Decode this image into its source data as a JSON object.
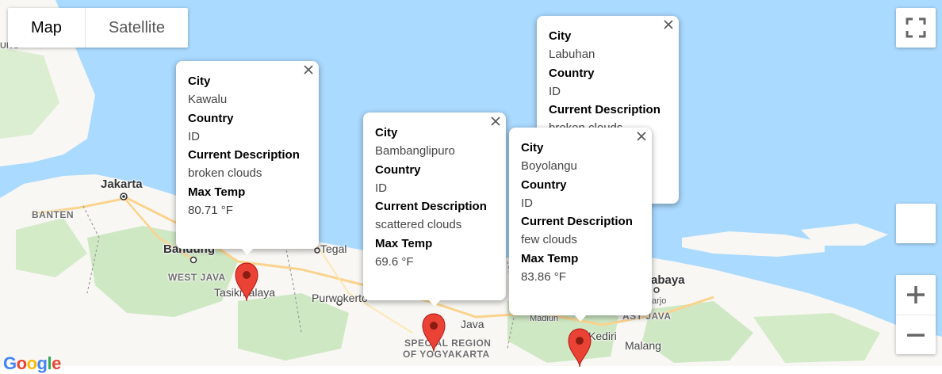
{
  "map_type": {
    "map_label": "Map",
    "satellite_label": "Satellite",
    "selected": "Map"
  },
  "controls": {
    "fullscreen_icon": "fullscreen-icon",
    "zoom_in_label": "+",
    "zoom_out_label": "−"
  },
  "places": {
    "jakarta": "Jakarta",
    "banten": "BANTEN",
    "bandung": "Bandung",
    "west_java": "WEST JAVA",
    "tasikmalaya": "Tasikmalaya",
    "tegal": "Tegal",
    "purwokerto": "Purwokerto",
    "special_region_1": "SPECIAL REGION",
    "special_region_2": "OF YOGYAKARTA",
    "java": "Java",
    "madiun": "Madiun",
    "kediri": "Kediri",
    "malang": "Malang",
    "surabaya": "abaya",
    "east_java": "AST JAVA",
    "sidoarjo": "arjo",
    "lampung_edge": "UNG"
  },
  "info_windows": [
    {
      "city_key": "City",
      "city": "Labuhan",
      "country_key": "Country",
      "country": "ID",
      "desc_key": "Current Description",
      "desc": "broken clouds"
    },
    {
      "city_key": "City",
      "city": "Kawalu",
      "country_key": "Country",
      "country": "ID",
      "desc_key": "Current Description",
      "desc": "broken clouds",
      "temp_key": "Max Temp",
      "temp": "80.71 °F"
    },
    {
      "city_key": "City",
      "city": "Bambanglipuro",
      "country_key": "Country",
      "country": "ID",
      "desc_key": "Current Description",
      "desc": "scattered clouds",
      "temp_key": "Max Temp",
      "temp": "69.6 °F"
    },
    {
      "city_key": "City",
      "city": "Boyolangu",
      "country_key": "Country",
      "country": "ID",
      "desc_key": "Current Description",
      "desc": "few clouds",
      "temp_key": "Max Temp",
      "temp": "83.86 °F"
    }
  ],
  "colors": {
    "water": "#aadaff",
    "land": "#f8f7f3",
    "park": "#cfe8c4",
    "marker": "#ea4335"
  },
  "logo": "Google"
}
